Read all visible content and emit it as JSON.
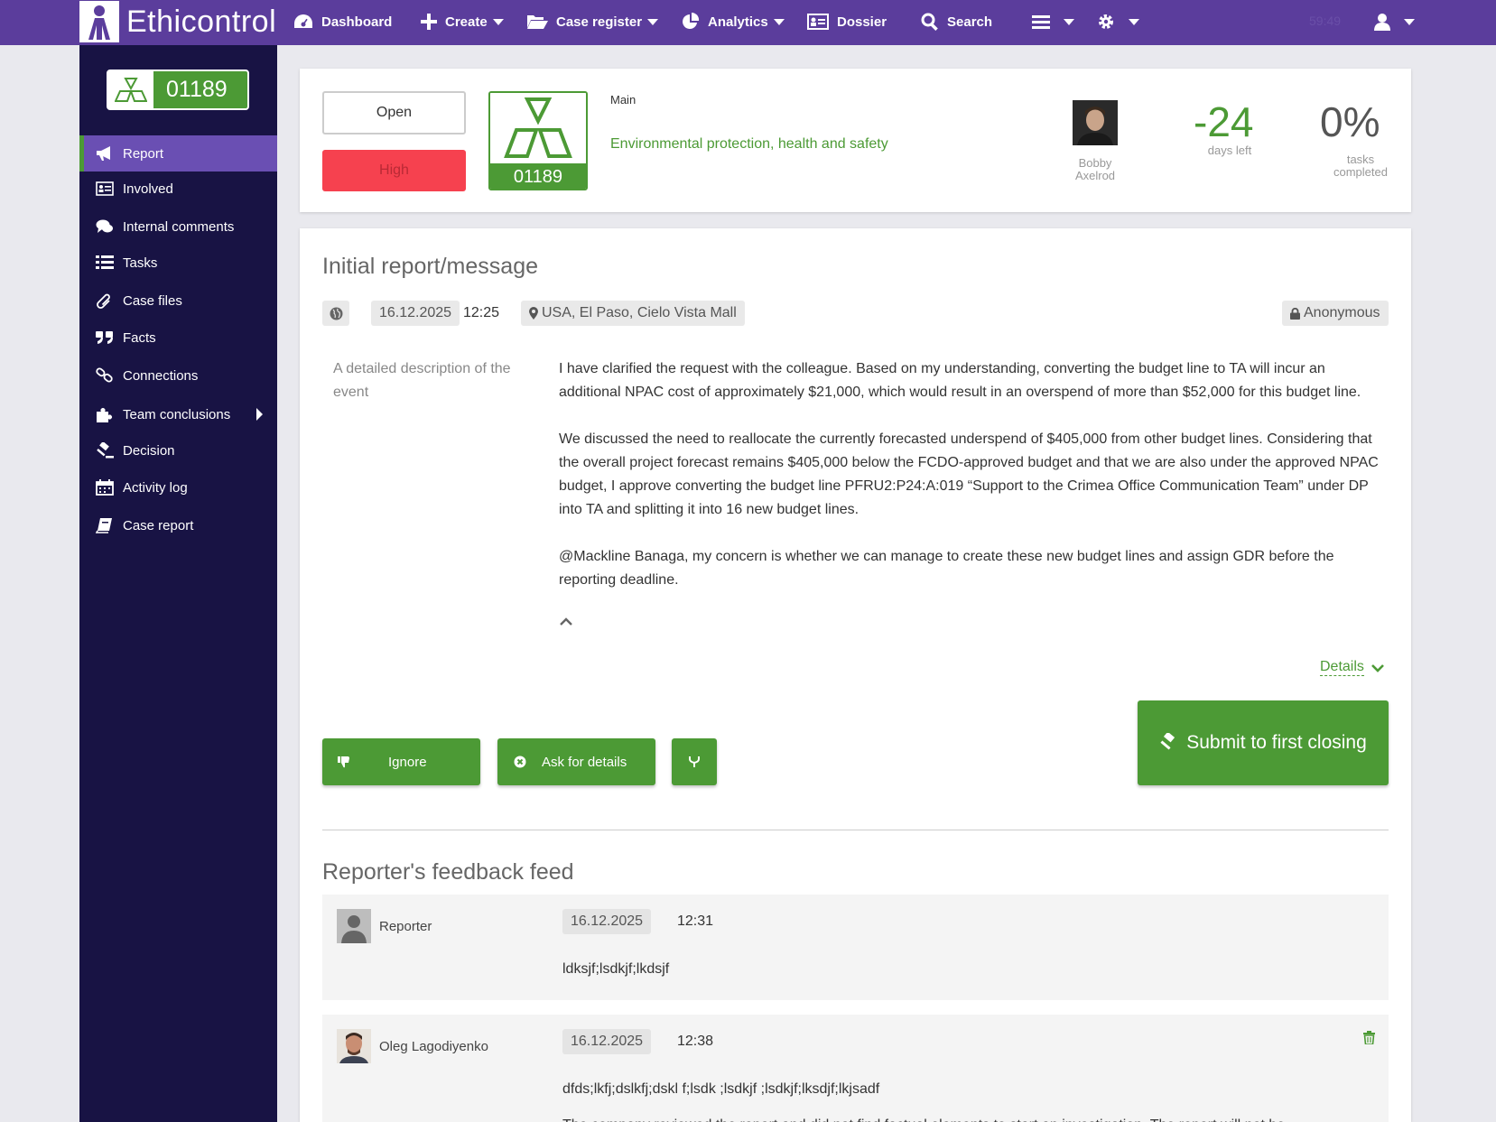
{
  "topbar": {
    "brand": "Ethicontrol",
    "nav": [
      "Dashboard",
      "Create",
      "Case register",
      "Analytics",
      "Dossier",
      "Search"
    ],
    "timer": "59:49"
  },
  "sidebar": {
    "case_number": "01189",
    "items": [
      "Report",
      "Involved",
      "Internal comments",
      "Tasks",
      "Case files",
      "Facts",
      "Connections",
      "Team conclusions",
      "Decision",
      "Activity log",
      "Case report"
    ]
  },
  "header": {
    "status": "Open",
    "priority": "High",
    "case_number": "01189",
    "category_label": "Main",
    "category_value": "Environmental protection, health and safety",
    "assignee": "Bobby Axelrod",
    "days_value": "-24",
    "days_label": "days left",
    "tasks_value": "0%",
    "tasks_label": "tasks completed"
  },
  "report": {
    "title": "Initial report/message",
    "date": "16.12.2025",
    "time": "12:25",
    "location": "USA, El Paso, Cielo Vista Mall",
    "anonymity": "Anonymous",
    "description_label": "A detailed description of the event",
    "paragraphs": [
      "I have clarified the request with the colleague. Based on my understanding, converting the budget line to TA will incur an additional NPAC cost of approximately $21,000, which would result in an overspend of more than $52,000 for this budget line.",
      "We discussed the need to reallocate the currently forecasted underspend of $405,000 from other budget lines. Considering that the overall project forecast remains $405,000 below the FCDO-approved budget and that we are also under the approved NPAC budget, I approve converting the budget line PFRU2:P24:A:019 “Support to the Crimea Office Communication Team” under DP into TA and splitting it into 16 new budget lines.",
      "@Mackline Banaga, my concern is whether we can manage to create these new budget lines and assign GDR before the reporting deadline."
    ],
    "details_link": "Details",
    "actions": {
      "ignore": "Ignore",
      "ask": "Ask for details",
      "submit": "Submit to first closing"
    }
  },
  "feedback": {
    "title": "Reporter's feedback feed",
    "entries": [
      {
        "author": "Reporter",
        "date": "16.12.2025",
        "time": "12:31",
        "message": "ldksjf;lsdkjf;lkdsjf"
      },
      {
        "author": "Oleg Lagodiyenko",
        "date": "16.12.2025",
        "time": "12:38",
        "message": "dfds;lkfj;dslkfj;dskl f;lsdk ;lsdkjf ;lsdkjf;lksdjf;lkjsadf",
        "message2": "The company reviewed the report and did not find factual elements to start an investigation. The report will not be"
      }
    ]
  },
  "colors": {
    "brand_purple": "#5b3d9c",
    "sidebar": "#181344",
    "accent_green": "#4c9a35",
    "danger": "#f6414f"
  }
}
